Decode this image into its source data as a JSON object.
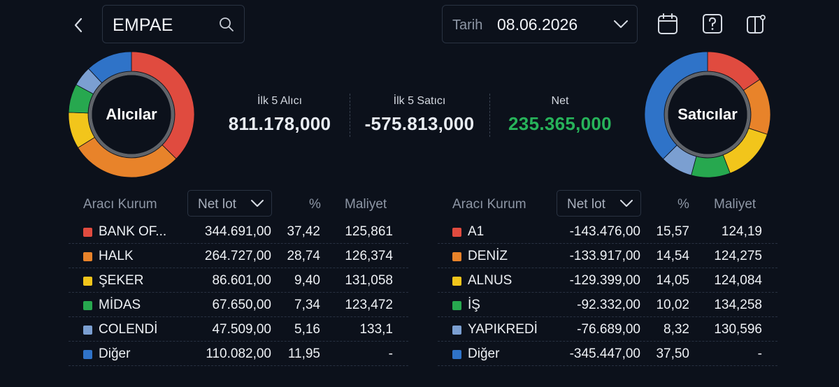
{
  "header": {
    "search_value": "EMPAE",
    "date_label": "Tarih",
    "date_value": "08.06.2026"
  },
  "buyers_donut": {
    "label": "Alıcılar",
    "segments": [
      {
        "name": "BANK OF...",
        "percent": 37.42,
        "color": "#e04b3f"
      },
      {
        "name": "HALK",
        "percent": 28.74,
        "color": "#e8832a"
      },
      {
        "name": "ŞEKER",
        "percent": 9.4,
        "color": "#f2c51b"
      },
      {
        "name": "MİDAS",
        "percent": 7.34,
        "color": "#27a84f"
      },
      {
        "name": "COLENDİ",
        "percent": 5.16,
        "color": "#7b9fd1"
      },
      {
        "name": "Diğer",
        "percent": 11.95,
        "color": "#2f73c8"
      }
    ]
  },
  "sellers_donut": {
    "label": "Satıcılar",
    "segments": [
      {
        "name": "A1",
        "percent": 15.57,
        "color": "#e04b3f"
      },
      {
        "name": "DENİZ",
        "percent": 14.54,
        "color": "#e8832a"
      },
      {
        "name": "ALNUS",
        "percent": 14.05,
        "color": "#f2c51b"
      },
      {
        "name": "İŞ",
        "percent": 10.02,
        "color": "#27a84f"
      },
      {
        "name": "YAPIKREDİ",
        "percent": 8.32,
        "color": "#7b9fd1"
      },
      {
        "name": "Diğer",
        "percent": 37.5,
        "color": "#2f73c8"
      }
    ]
  },
  "summary": {
    "buyers_caption": "İlk 5 Alıcı",
    "buyers_value": "811.178,000",
    "sellers_caption": "İlk 5 Satıcı",
    "sellers_value": "-575.813,000",
    "net_caption": "Net",
    "net_value": "235.365,000",
    "net_color": "#27b35a"
  },
  "buyers_table": {
    "col_broker": "Aracı Kurum",
    "col_netlot": "Net lot",
    "col_percent": "%",
    "col_cost": "Maliyet",
    "rows": [
      {
        "name": "BANK OF...",
        "net": "344.691,00",
        "pct": "37,42",
        "cost": "125,861",
        "color": "#e04b3f"
      },
      {
        "name": "HALK",
        "net": "264.727,00",
        "pct": "28,74",
        "cost": "126,374",
        "color": "#e8832a"
      },
      {
        "name": "ŞEKER",
        "net": "86.601,00",
        "pct": "9,40",
        "cost": "131,058",
        "color": "#f2c51b"
      },
      {
        "name": "MİDAS",
        "net": "67.650,00",
        "pct": "7,34",
        "cost": "123,472",
        "color": "#27a84f"
      },
      {
        "name": "COLENDİ",
        "net": "47.509,00",
        "pct": "5,16",
        "cost": "133,1",
        "color": "#7b9fd1"
      },
      {
        "name": "Diğer",
        "net": "110.082,00",
        "pct": "11,95",
        "cost": "-",
        "color": "#2f73c8"
      }
    ]
  },
  "sellers_table": {
    "col_broker": "Aracı Kurum",
    "col_netlot": "Net lot",
    "col_percent": "%",
    "col_cost": "Maliyet",
    "rows": [
      {
        "name": "A1",
        "net": "-143.476,00",
        "pct": "15,57",
        "cost": "124,19",
        "color": "#e04b3f"
      },
      {
        "name": "DENİZ",
        "net": "-133.917,00",
        "pct": "14,54",
        "cost": "124,275",
        "color": "#e8832a"
      },
      {
        "name": "ALNUS",
        "net": "-129.399,00",
        "pct": "14,05",
        "cost": "124,084",
        "color": "#f2c51b"
      },
      {
        "name": "İŞ",
        "net": "-92.332,00",
        "pct": "10,02",
        "cost": "134,258",
        "color": "#27a84f"
      },
      {
        "name": "YAPIKREDİ",
        "net": "-76.689,00",
        "pct": "8,32",
        "cost": "130,596",
        "color": "#7b9fd1"
      },
      {
        "name": "Diğer",
        "net": "-345.447,00",
        "pct": "37,50",
        "cost": "-",
        "color": "#2f73c8"
      }
    ]
  },
  "icons": {
    "back": "chevron-left-icon",
    "search": "search-icon",
    "dropdown": "chevron-down-icon",
    "calendar": "calendar-icon",
    "help": "help-icon",
    "layout": "layout-settings-icon"
  }
}
